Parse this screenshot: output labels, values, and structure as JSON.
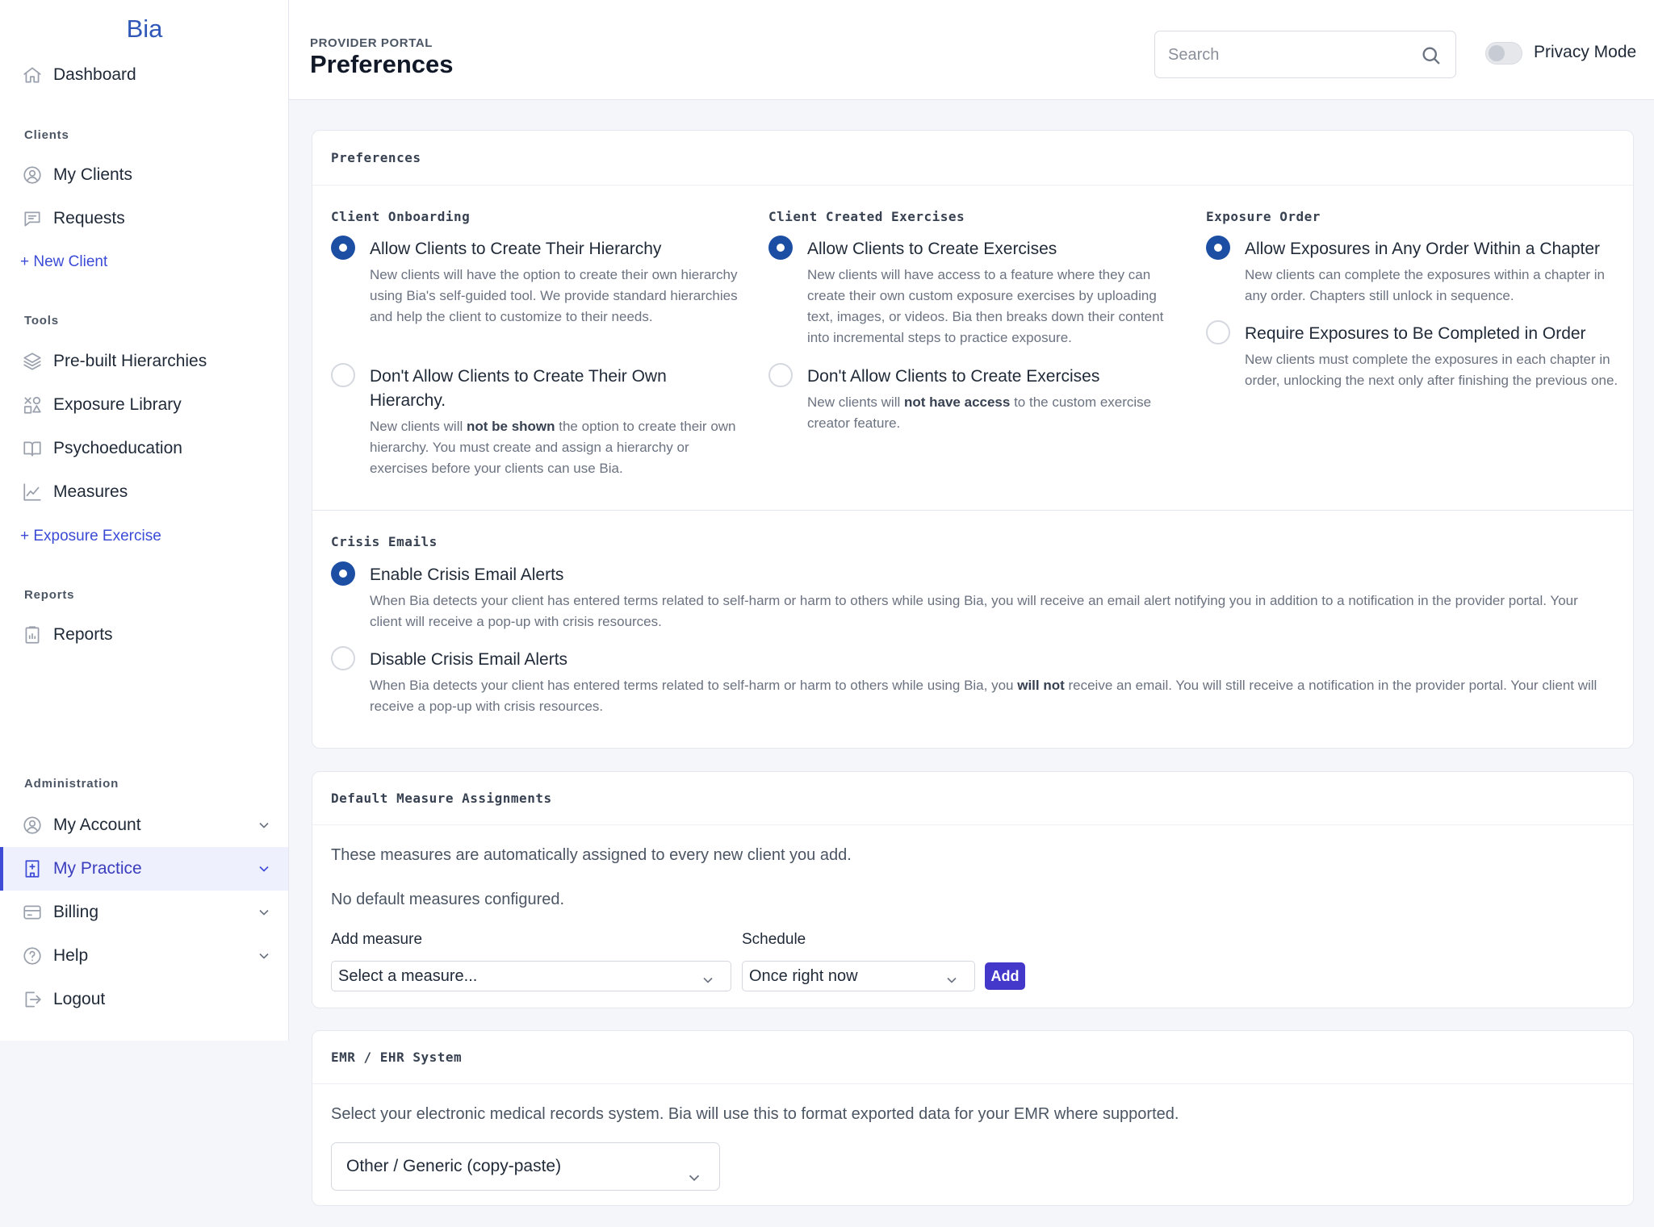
{
  "sidebar": {
    "brand": "Bia",
    "dashboard": "Dashboard",
    "sections": {
      "clients": "Clients",
      "tools": "Tools",
      "reports": "Reports",
      "administration": "Administration"
    },
    "my_clients": "My Clients",
    "requests": "Requests",
    "new_client": "+ New Client",
    "prebuilt_hierarchies": "Pre-built Hierarchies",
    "exposure_library": "Exposure Library",
    "psychoeducation": "Psychoeducation",
    "measures": "Measures",
    "exposure_exercise": "+ Exposure Exercise",
    "reports": "Reports",
    "my_account": "My Account",
    "my_practice": "My Practice",
    "billing": "Billing",
    "help": "Help",
    "logout": "Logout"
  },
  "header": {
    "portal_label": "PROVIDER PORTAL",
    "title": "Preferences",
    "search_placeholder": "Search",
    "privacy_mode": "Privacy Mode",
    "privacy_on": false
  },
  "preferences": {
    "title": "Preferences",
    "client_onboarding": {
      "title": "Client Onboarding",
      "opt1_label": "Allow Clients to Create Their Hierarchy",
      "opt1_desc": "New clients will have the option to create their own hierarchy using Bia's self-guided tool. We provide standard hierarchies and help the client to customize to their needs.",
      "opt2_label": "Don't Allow Clients to Create Their Own Hierarchy.",
      "opt2_desc_a": "New clients will ",
      "opt2_desc_b": "not be shown",
      "opt2_desc_c": " the option to create their own hierarchy. You must create and assign a hierarchy or exercises before your clients can use Bia."
    },
    "client_exercises": {
      "title": "Client Created Exercises",
      "opt1_label": "Allow Clients to Create Exercises",
      "opt1_desc": "New clients will have access to a feature where they can create their own custom exposure exercises by uploading text, images, or videos. Bia then breaks down their content into incremental steps to practice exposure.",
      "opt2_label": "Don't Allow Clients to Create Exercises",
      "opt2_desc_a": "New clients will ",
      "opt2_desc_b": "not have access",
      "opt2_desc_c": " to the custom exercise creator feature."
    },
    "exposure_order": {
      "title": "Exposure Order",
      "opt1_label": "Allow Exposures in Any Order Within a Chapter",
      "opt1_desc": "New clients can complete the exposures within a chapter in any order. Chapters still unlock in sequence.",
      "opt2_label": "Require Exposures to Be Completed in Order",
      "opt2_desc": "New clients must complete the exposures in each chapter in order, unlocking the next only after finishing the previous one."
    },
    "crisis_emails": {
      "title": "Crisis Emails",
      "opt1_label": "Enable Crisis Email Alerts",
      "opt1_desc": "When Bia detects your client has entered terms related to self-harm or harm to others while using Bia, you will receive an email alert notifying you in addition to a notification in the provider portal. Your client will receive a pop-up with crisis resources.",
      "opt2_label": "Disable Crisis Email Alerts",
      "opt2_desc_a": "When Bia detects your client has entered terms related to self-harm or harm to others while using Bia, you ",
      "opt2_desc_b": "will not",
      "opt2_desc_c": " receive an email. You will still receive a notification in the provider portal. Your client will receive a pop-up with crisis resources."
    }
  },
  "default_measures": {
    "title": "Default Measure Assignments",
    "intro": "These measures are automatically assigned to every new client you add.",
    "empty": "No default measures configured.",
    "add_measure_label": "Add measure",
    "measure_select": "Select a measure...",
    "schedule_label": "Schedule",
    "schedule_select": "Once right now",
    "add_button": "Add"
  },
  "emr": {
    "title": "EMR / EHR System",
    "intro": "Select your electronic medical records system. Bia will use this to format exported data for your EMR where supported.",
    "select": "Other / Generic (copy-paste)"
  }
}
